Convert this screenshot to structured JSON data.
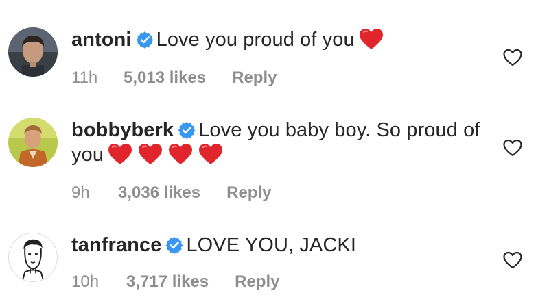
{
  "comments": [
    {
      "username": "antoni",
      "verified": true,
      "text": "Love you proud of you",
      "hearts": 1,
      "time": "11h",
      "likes": "5,013 likes",
      "reply": "Reply",
      "avatar": "avatar-photo-antoni"
    },
    {
      "username": "bobbyberk",
      "verified": true,
      "text": "Love you baby boy. So proud of you",
      "hearts": 4,
      "time": "9h",
      "likes": "3,036 likes",
      "reply": "Reply",
      "avatar": "avatar-photo-bobbyberk"
    },
    {
      "username": "tanfrance",
      "verified": true,
      "text": "LOVE YOU, JACKI",
      "hearts": 0,
      "time": "10h",
      "likes": "3,717 likes",
      "reply": "Reply",
      "avatar": "avatar-illustration-tanfrance"
    }
  ],
  "icons": {
    "verified": "verified-badge-icon",
    "like": "heart-outline-icon",
    "emoji": "red-heart-emoji"
  },
  "colors": {
    "verified_blue": "#3897f0",
    "text": "#262626",
    "meta": "#8e8e8e",
    "heart_red": "#e0262c"
  }
}
